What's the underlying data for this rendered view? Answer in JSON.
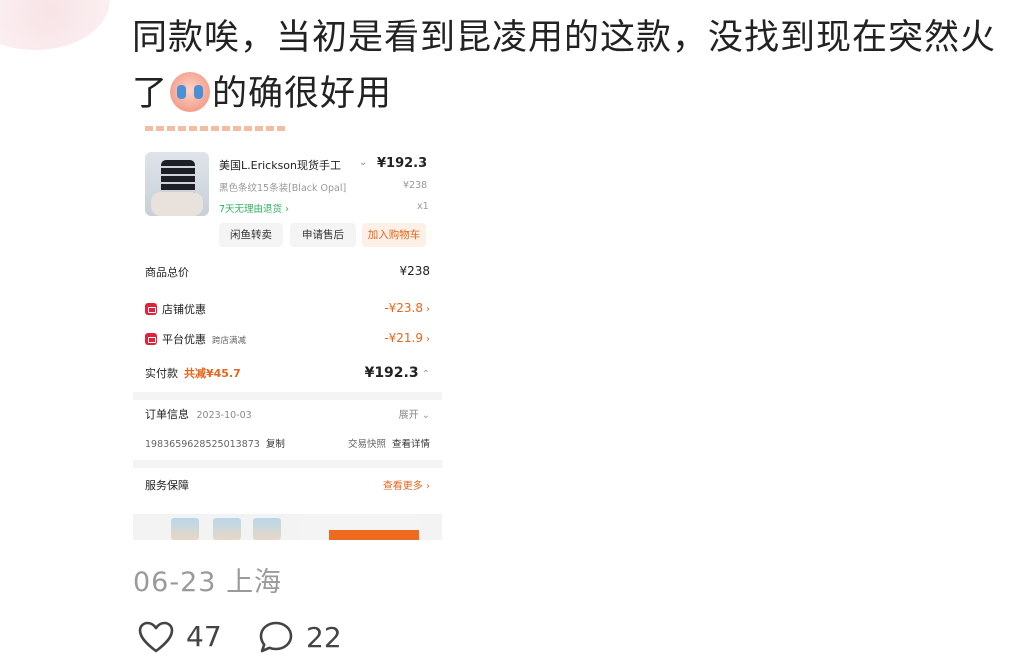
{
  "comment": {
    "line1": "同款唉，当初是看到昆凌用的这款，没找到现在突然火",
    "line2_prefix": "了",
    "emoji": "crying-face",
    "line2_suffix": "的确很好用"
  },
  "order_screenshot": {
    "product": {
      "title": "美国L.Erickson现货手工",
      "price": "¥192.3",
      "variant": "黑色条纹15条装[Black Opal]",
      "original_price": "¥238",
      "return_policy": "7天无理由退货 ›",
      "quantity": "x1"
    },
    "buttons": [
      "闲鱼转卖",
      "申请售后",
      "加入购物车"
    ],
    "summary": {
      "total_label": "商品总价",
      "total_value": "¥238",
      "store_discount_label": "店铺优惠",
      "store_discount_value": "-¥23.8",
      "platform_discount_label": "平台优惠",
      "platform_discount_sub": "跨店满减",
      "platform_discount_value": "-¥21.9",
      "paid_label": "实付款",
      "paid_saved": "共减¥45.7",
      "paid_value": "¥192.3"
    },
    "order_info": {
      "label": "订单信息",
      "date": "2023-10-03",
      "expand": "展开",
      "order_no": "1983659628525013873",
      "copy": "复制",
      "snapshot": "交易快照",
      "detail": "查看详情"
    },
    "service": {
      "label": "服务保障",
      "more": "查看更多 ›"
    }
  },
  "meta": {
    "date": "06-23",
    "location": "上海"
  },
  "reactions": {
    "likes": "47",
    "comments": "22"
  },
  "colors": {
    "accent_orange": "#e8651d",
    "discount_red": "#e2223a",
    "return_green": "#2fae5e",
    "meta_gray": "#9a9a9a"
  }
}
